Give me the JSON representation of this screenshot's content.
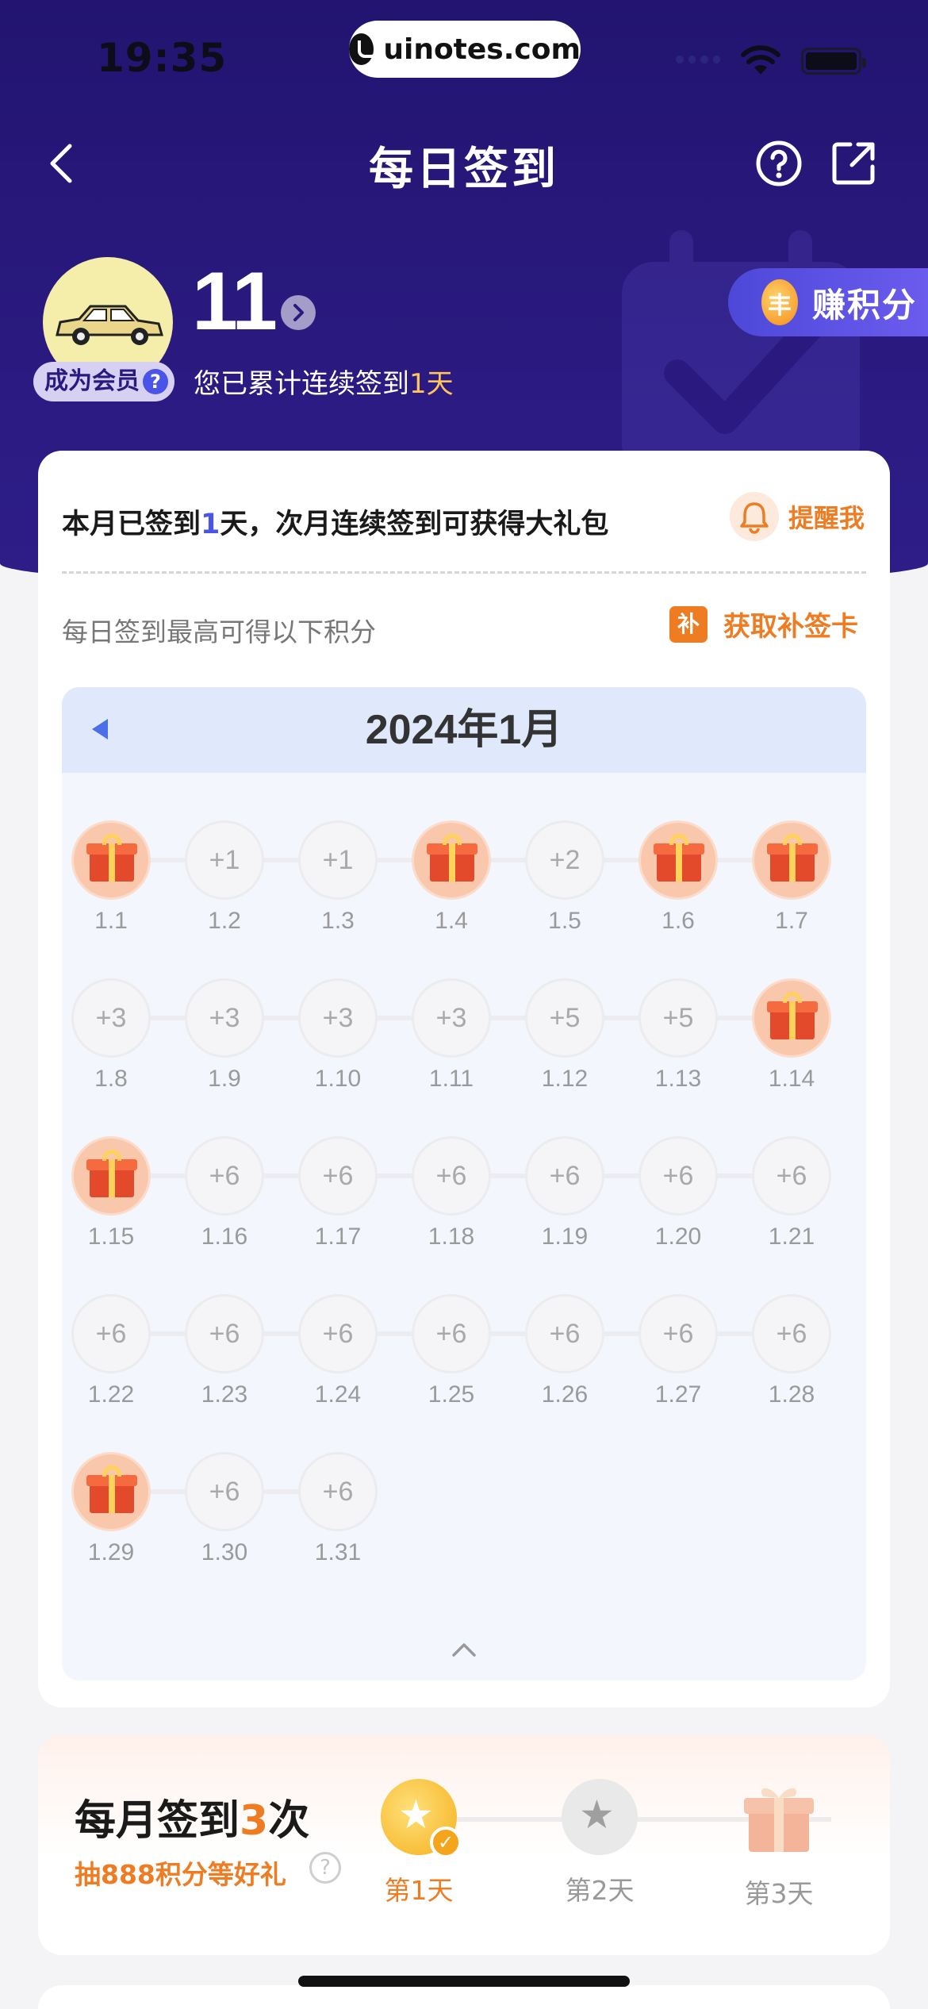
{
  "status_bar": {
    "time": "19:35",
    "url": "uinotes.com"
  },
  "nav": {
    "title": "每日签到"
  },
  "profile": {
    "streak_count": "11",
    "member_badge": "成为会员",
    "member_help": "?",
    "streak_text_prefix": "您已累计连续签到",
    "streak_days": "1天"
  },
  "earn_points": {
    "label": "赚积分"
  },
  "sign_card": {
    "head_prefix": "本月已签到",
    "head_days": "1",
    "head_suffix": "天，次月连续签到可获得大礼包",
    "remind_label": "提醒我",
    "sub_head": "每日签到最高可得以下积分",
    "makeup_label": "获取补签卡",
    "makeup_icon_text": "补"
  },
  "calendar": {
    "title": "2024年1月",
    "days": [
      {
        "date": "1.1",
        "reward": "gift"
      },
      {
        "date": "1.2",
        "reward": "+1"
      },
      {
        "date": "1.3",
        "reward": "+1"
      },
      {
        "date": "1.4",
        "reward": "gift"
      },
      {
        "date": "1.5",
        "reward": "+2"
      },
      {
        "date": "1.6",
        "reward": "gift"
      },
      {
        "date": "1.7",
        "reward": "gift"
      },
      {
        "date": "1.8",
        "reward": "+3"
      },
      {
        "date": "1.9",
        "reward": "+3"
      },
      {
        "date": "1.10",
        "reward": "+3"
      },
      {
        "date": "1.11",
        "reward": "+3"
      },
      {
        "date": "1.12",
        "reward": "+5"
      },
      {
        "date": "1.13",
        "reward": "+5"
      },
      {
        "date": "1.14",
        "reward": "gift"
      },
      {
        "date": "1.15",
        "reward": "gift"
      },
      {
        "date": "1.16",
        "reward": "+6"
      },
      {
        "date": "1.17",
        "reward": "+6"
      },
      {
        "date": "1.18",
        "reward": "+6"
      },
      {
        "date": "1.19",
        "reward": "+6"
      },
      {
        "date": "1.20",
        "reward": "+6"
      },
      {
        "date": "1.21",
        "reward": "+6"
      },
      {
        "date": "1.22",
        "reward": "+6"
      },
      {
        "date": "1.23",
        "reward": "+6"
      },
      {
        "date": "1.24",
        "reward": "+6"
      },
      {
        "date": "1.25",
        "reward": "+6"
      },
      {
        "date": "1.26",
        "reward": "+6"
      },
      {
        "date": "1.27",
        "reward": "+6"
      },
      {
        "date": "1.28",
        "reward": "+6"
      },
      {
        "date": "1.29",
        "reward": "gift"
      },
      {
        "date": "1.30",
        "reward": "+6"
      },
      {
        "date": "1.31",
        "reward": "+6"
      }
    ]
  },
  "monthly_bonus": {
    "title_prefix": "每月签到",
    "title_count": "3",
    "title_suffix": "次",
    "subtitle": "抽888积分等好礼",
    "help": "?",
    "steps": [
      {
        "label": "第1天",
        "state": "done"
      },
      {
        "label": "第2天",
        "state": "pending"
      },
      {
        "label": "第3天",
        "state": "gift"
      }
    ]
  },
  "colors": {
    "header": "#221470",
    "accent_orange": "#ee7c23",
    "accent_blue": "#4a54e8"
  }
}
